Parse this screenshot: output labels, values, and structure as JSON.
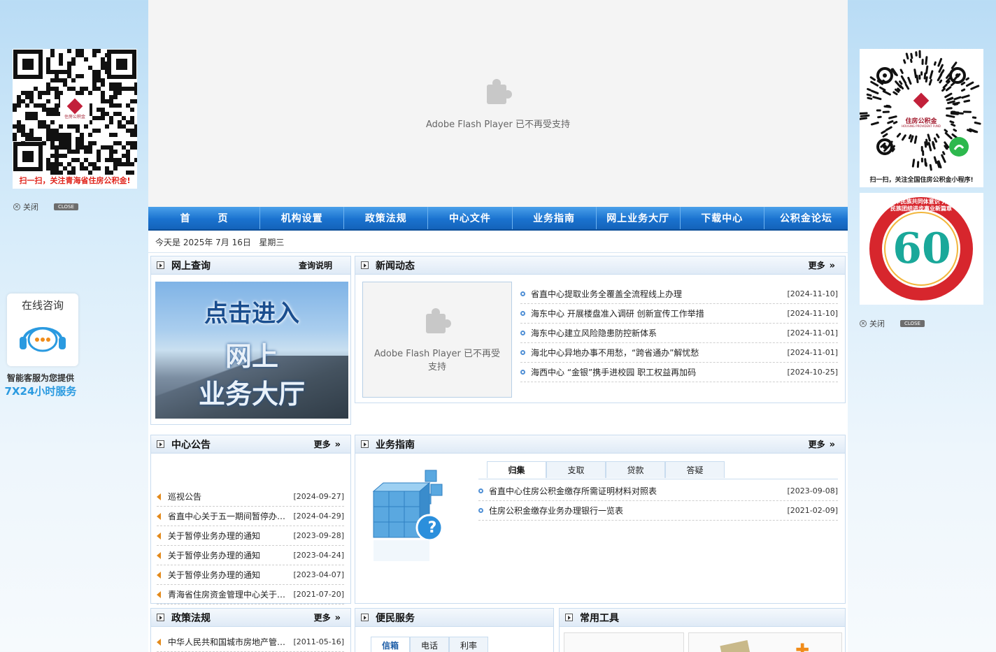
{
  "flash": {
    "message": "Adobe Flash Player 已不再受支持"
  },
  "nav": [
    "首页",
    "机构设置",
    "政策法规",
    "中心文件",
    "业务指南",
    "网上业务大厅",
    "下载中心",
    "公积金论坛"
  ],
  "date_text": "今天是 2025年 7月 16日   星期三",
  "online_query": {
    "title": "网上查询",
    "link": "查询说明",
    "banner_lines": [
      "点击进入",
      "网上",
      "业务大厅"
    ]
  },
  "news": {
    "title": "新闻动态",
    "more": "更多",
    "flash_message": "Adobe Flash Player 已不再受支持",
    "items": [
      {
        "title": "省直中心提取业务全覆盖全流程线上办理",
        "date": "[2024-11-10]"
      },
      {
        "title": "海东中心 开展楼盘准入调研 创新宣传工作举措",
        "date": "[2024-11-10]"
      },
      {
        "title": "海东中心建立风险隐患防控新体系",
        "date": "[2024-11-01]"
      },
      {
        "title": "海北中心异地办事不用愁，“跨省通办”解忧愁",
        "date": "[2024-11-01]"
      },
      {
        "title": "海西中心 “金银”携手进校园 职工权益再加码",
        "date": "[2024-10-25]"
      }
    ]
  },
  "notice": {
    "title": "中心公告",
    "more": "更多",
    "items": [
      {
        "title": "巡视公告",
        "date": "[2024-09-27]"
      },
      {
        "title": "省直中心关于五一期间暂停办理业务的通知",
        "date": "[2024-04-29]"
      },
      {
        "title": "关于暂停业务办理的通知",
        "date": "[2023-09-28]"
      },
      {
        "title": "关于暂停业务办理的通知",
        "date": "[2023-04-24]"
      },
      {
        "title": "关于暂停业务办理的通知",
        "date": "[2023-04-07]"
      },
      {
        "title": "青海省住房资金管理中心关于调整住房公积金业务的通知",
        "date": "[2021-07-20]"
      }
    ]
  },
  "guide": {
    "title": "业务指南",
    "more": "更多",
    "tabs": [
      "归集",
      "支取",
      "贷款",
      "答疑"
    ],
    "items": [
      {
        "title": "省直中心住房公积金缴存所需证明材料对照表",
        "date": "[2023-09-08]"
      },
      {
        "title": "住房公积金缴存业务办理银行一览表",
        "date": "[2021-02-09]"
      }
    ]
  },
  "policy": {
    "title": "政策法规",
    "more": "更多",
    "items": [
      {
        "title": "中华人民共和国城市房地产管理法",
        "date": "[2011-05-16]"
      }
    ]
  },
  "service": {
    "title": "便民服务",
    "tabs": [
      "信箱",
      "电话",
      "利率"
    ]
  },
  "tools": {
    "title": "常用工具"
  },
  "left_qr": {
    "caption": "扫一扫，关注青海省住房公积金!",
    "close": "关闭",
    "close_btn": "CLOSE",
    "logo_text": "住房公积金"
  },
  "right_qr": {
    "caption": "扫一扫，关注全国住房公积金小程序!",
    "logo_text": "住房公积金",
    "logo_sub": "HOUSING PROVIDENT FUND",
    "close": "关闭",
    "close_btn": "CLOSE"
  },
  "right_badge": {
    "ring_text": "铸牢中华民族共同体意识 开创青海民族团结进步事业新篇章",
    "number": "60"
  },
  "consult": {
    "title": "在线咨询",
    "line1": "智能客服为您提供",
    "line2": "7X24小时服务"
  },
  "colors": {
    "nav": "#1a72cf",
    "accent": "#4f8fd5",
    "notice_icon": "#e38a1c",
    "qr_caption": "#e0241b"
  }
}
